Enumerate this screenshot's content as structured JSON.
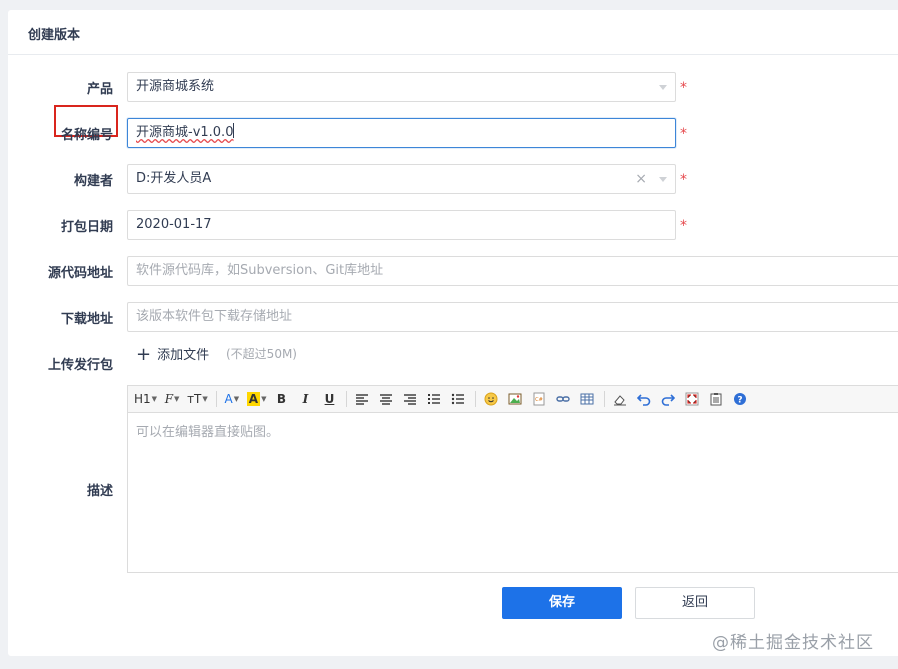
{
  "panel": {
    "title": "创建版本"
  },
  "form": {
    "required_mark": "*",
    "product": {
      "label": "产品",
      "value": "开源商城系统"
    },
    "name": {
      "label": "名称编号",
      "value": "开源商城-v1.0.0"
    },
    "builder": {
      "label": "构建者",
      "value": "D:开发人员A",
      "clear": "×"
    },
    "date": {
      "label": "打包日期",
      "value": "2020-01-17"
    },
    "source": {
      "label": "源代码地址",
      "placeholder": "软件源代码库，如Subversion、Git库地址"
    },
    "download": {
      "label": "下载地址",
      "placeholder": "该版本软件包下载存储地址"
    },
    "upload": {
      "label": "上传发行包",
      "button": "添加文件",
      "limit": "(不超过50M)"
    },
    "description": {
      "label": "描述",
      "placeholder": "可以在编辑器直接贴图。"
    }
  },
  "toolbar": {
    "heading": "H1",
    "font_family": "F",
    "font_size": "тT",
    "font_color": "A",
    "bg_color": "A",
    "bold": "B",
    "italic": "I",
    "underline": "U"
  },
  "actions": {
    "save": "保存",
    "back": "返回"
  },
  "watermark": "@稀土掘金技术社区",
  "colors": {
    "primary": "#1d72e8",
    "required": "#e6494d",
    "highlight_box": "#d9251d"
  }
}
